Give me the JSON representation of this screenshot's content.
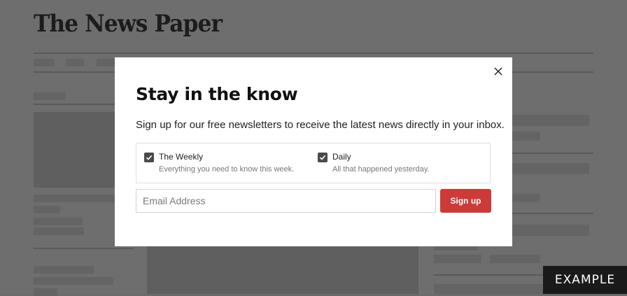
{
  "background": {
    "logo": "The News Paper"
  },
  "modal": {
    "title": "Stay in the know",
    "description": "Sign up for our free newsletters to receive the latest news directly in your inbox.",
    "close_icon": "close-icon",
    "options": [
      {
        "label": "The Weekly",
        "sublabel": "Everything you need to know this week.",
        "checked": true
      },
      {
        "label": "Daily",
        "sublabel": "All that happened yesterday.",
        "checked": true
      }
    ],
    "email": {
      "placeholder": "Email Address",
      "value": ""
    },
    "signup_label": "Sign up"
  },
  "badge": "EXAMPLE",
  "colors": {
    "accent": "#cc3b37",
    "overlay": "#6e6e6e",
    "badge": "#1a1a1a"
  }
}
